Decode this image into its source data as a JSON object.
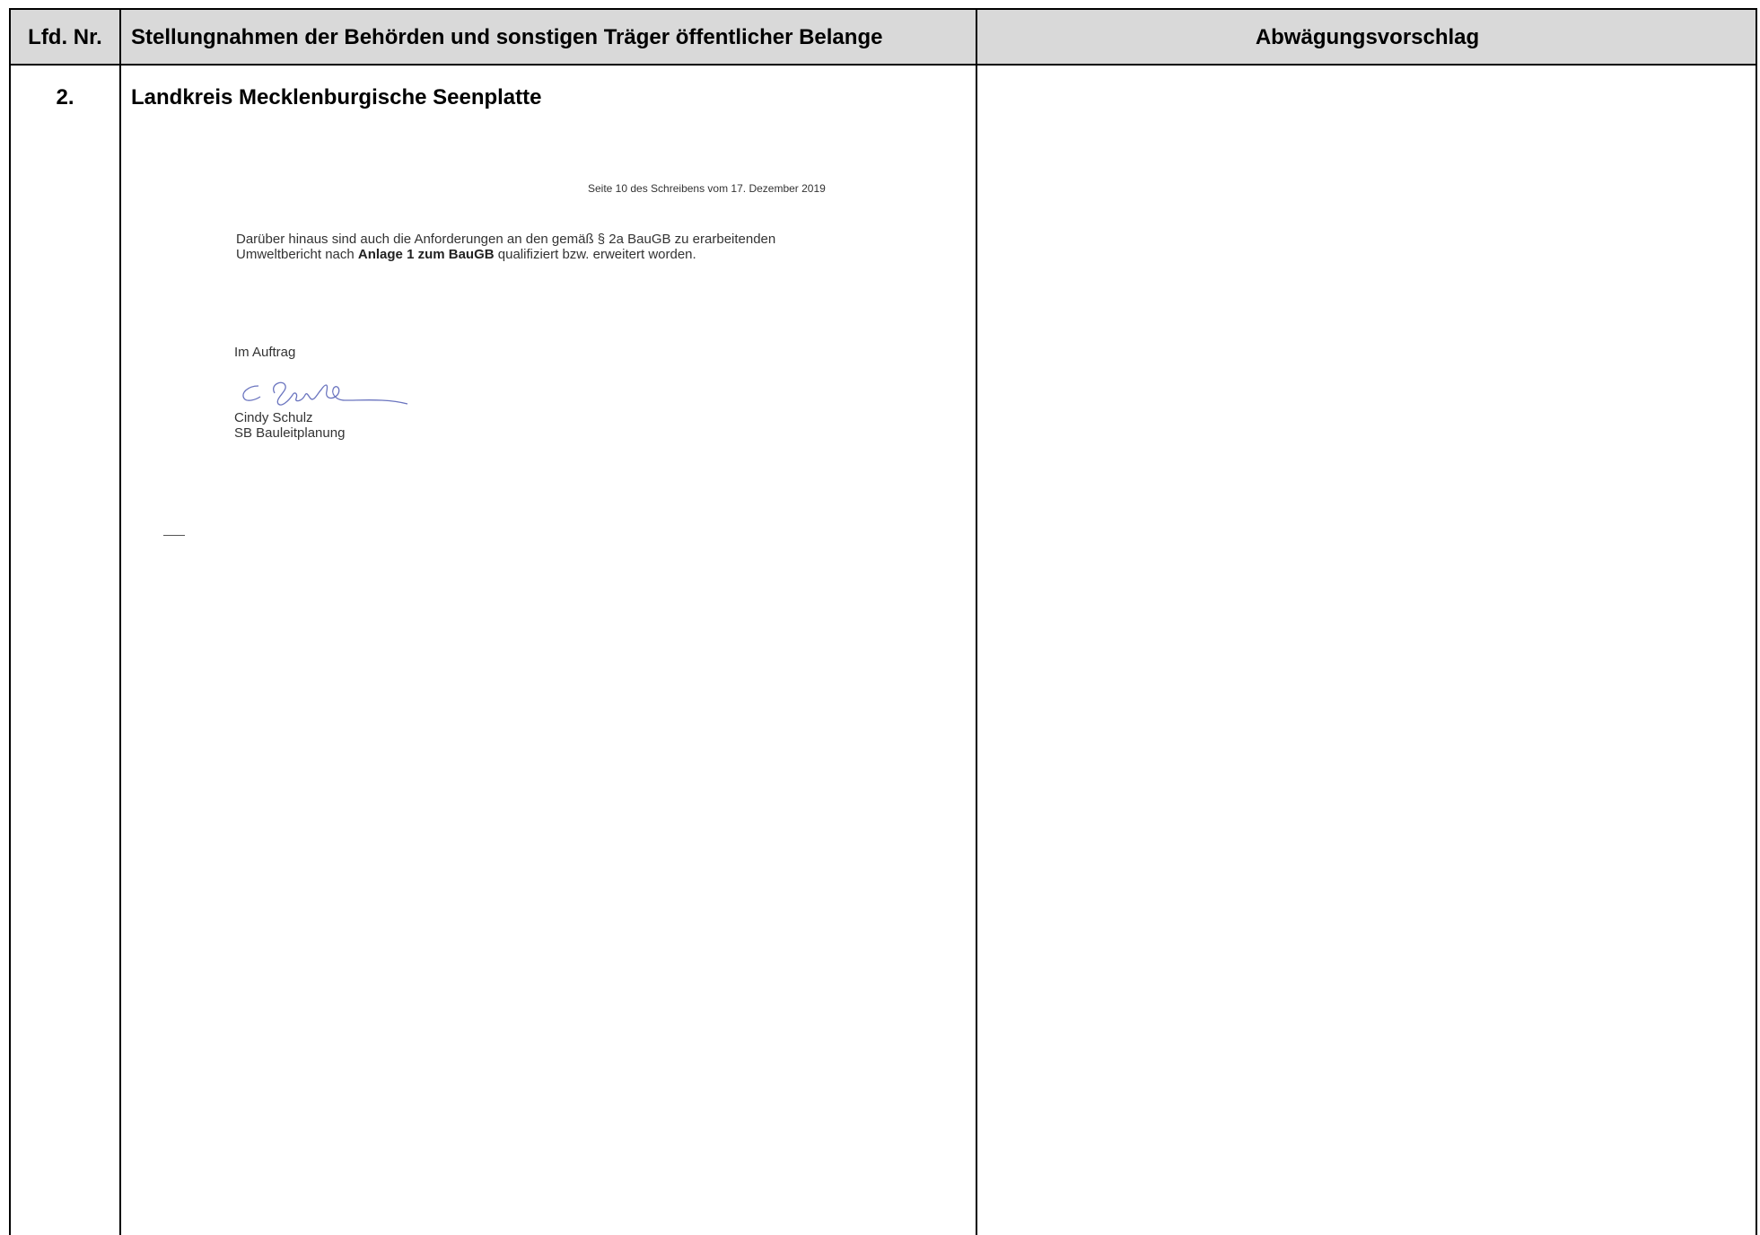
{
  "table": {
    "headers": {
      "lfd_nr": "Lfd. Nr.",
      "stellungnahmen": "Stellungnahmen der Behörden und sonstigen Träger öffentlicher Belange",
      "abwaegung": "Abwägungsvorschlag"
    },
    "row": {
      "number": "2.",
      "title": "Landkreis Mecklenburgische Seenplatte"
    }
  },
  "letter": {
    "page_reference": "Seite 10 des Schreibens vom 17. Dezember 2019",
    "paragraph_line1": "Darüber hinaus sind auch die Anforderungen an den gemäß § 2a BauGB zu erarbeitenden",
    "paragraph_line2_prefix": "Umweltbericht nach ",
    "paragraph_line2_bold": "Anlage 1 zum BauGB",
    "paragraph_line2_suffix": " qualifiziert bzw. erweitert worden.",
    "closing": "Im Auftrag",
    "signer_name": "Cindy Schulz",
    "signer_title": "SB Bauleitplanung"
  },
  "colors": {
    "header_background": "#d9d9d9",
    "signature_ink": "#5a67b8"
  }
}
